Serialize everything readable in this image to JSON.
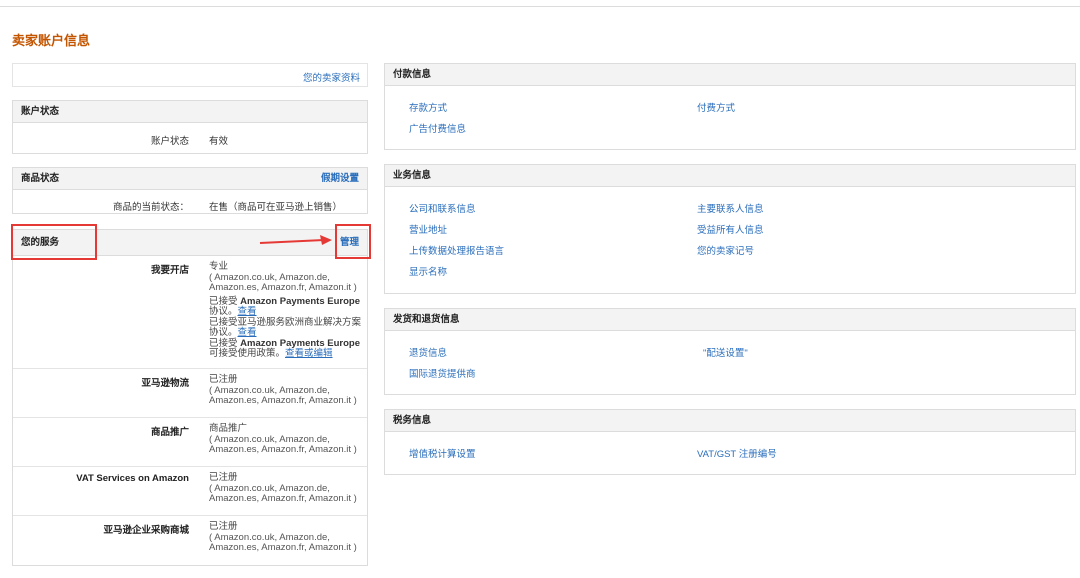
{
  "page": {
    "title": "卖家账户信息"
  },
  "profile": {
    "link": "您的卖家资料"
  },
  "account_status": {
    "header": "账户状态",
    "label": "账户状态",
    "value": "有效"
  },
  "product_status": {
    "header": "商品状态",
    "holiday_link": "假期设置",
    "label": "商品的当前状态：",
    "value": "在售（商品可在亚马逊上销售）"
  },
  "services": {
    "header": "您的服务",
    "manage_link": "管理",
    "items": [
      {
        "label": "我要开店",
        "lines": [
          "专业",
          "( Amazon.co.uk, Amazon.de,",
          "Amazon.es, Amazon.fr, Amazon.it )"
        ],
        "notes": [
          {
            "prefix": "已接受 ",
            "bold": "Amazon Payments Europe",
            "suffix": "",
            "line2": "协议。",
            "link": "查看"
          },
          {
            "prefix": "已接受亚马逊服务欧洲商业解决方案",
            "bold": "",
            "suffix": "",
            "line2": "协议。",
            "link": "查看"
          },
          {
            "prefix": "已接受 ",
            "bold": "Amazon Payments Europe",
            "suffix": "",
            "line2": "可接受使用政策。",
            "link": "查看或编辑"
          }
        ]
      },
      {
        "label": "亚马逊物流",
        "lines": [
          "已注册",
          "( Amazon.co.uk, Amazon.de,",
          "Amazon.es, Amazon.fr, Amazon.it )"
        ]
      },
      {
        "label": "商品推广",
        "lines": [
          "商品推广",
          "( Amazon.co.uk, Amazon.de,",
          "Amazon.es, Amazon.fr, Amazon.it )"
        ]
      },
      {
        "label": "VAT Services on Amazon",
        "lines": [
          "已注册",
          "( Amazon.co.uk, Amazon.de,",
          "Amazon.es, Amazon.fr, Amazon.it )"
        ]
      },
      {
        "label": "亚马逊企业采购商城",
        "lines": [
          "已注册",
          "( Amazon.co.uk, Amazon.de,",
          "Amazon.es, Amazon.fr, Amazon.it )"
        ]
      }
    ]
  },
  "payment_info": {
    "header": "付款信息",
    "links": [
      "存款方式",
      "付费方式",
      "广告付费信息"
    ]
  },
  "business_info": {
    "header": "业务信息",
    "links": [
      "公司和联系信息",
      "主要联系人信息",
      "营业地址",
      "受益所有人信息",
      "上传数据处理报告语言",
      "您的卖家记号",
      "显示名称"
    ]
  },
  "shipping_info": {
    "header": "发货和退货信息",
    "links": [
      "退货信息",
      "\"配送设置\"",
      "国际退货提供商"
    ]
  },
  "tax_info": {
    "header": "税务信息",
    "links": [
      "增值税计算设置",
      "VAT/GST 注册编号"
    ]
  },
  "colors": {
    "title": "#c45500",
    "link": "#2a6ebb",
    "highlight": "#e53935"
  }
}
